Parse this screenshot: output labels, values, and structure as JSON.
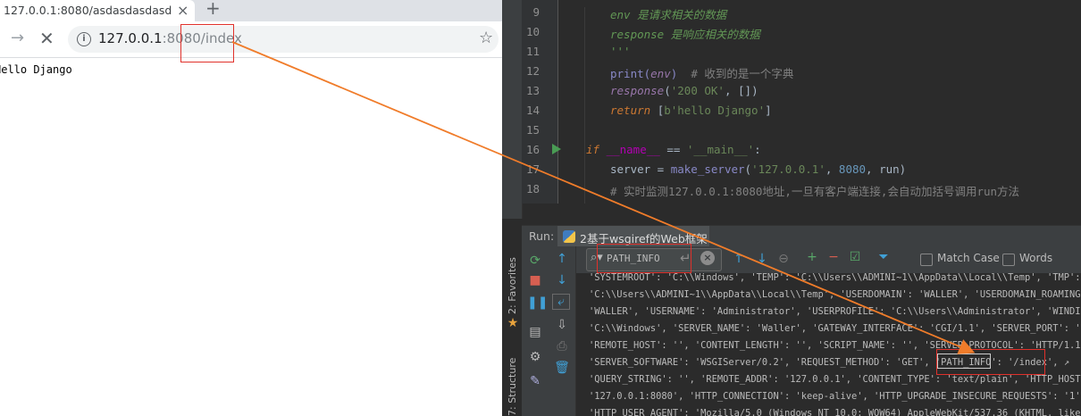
{
  "browser": {
    "tab_title": "127.0.0.1:8080/asdasdasdasd",
    "tab_close": "×",
    "new_tab": "+",
    "forward": "→",
    "stop": "✕",
    "info_icon": "i",
    "url_host": "127.0.0.1",
    "url_rest": ":8080/index",
    "star": "☆",
    "page_text": "Hello Django"
  },
  "editor": {
    "lines": [
      {
        "n": "9"
      },
      {
        "n": "10"
      },
      {
        "n": "11"
      },
      {
        "n": "12"
      },
      {
        "n": "13"
      },
      {
        "n": "14"
      },
      {
        "n": "15"
      },
      {
        "n": "16"
      },
      {
        "n": "17"
      },
      {
        "n": "18"
      }
    ],
    "code": {
      "l9": "env 是请求相关的数据",
      "l10": "response 是响应相关的数据",
      "l11": "'''",
      "l12_a": "print(",
      "l12_b": "env",
      "l12_c": ")  ",
      "l12_d": "# 收到的是一个字典",
      "l13_a": "response",
      "l13_b": "(",
      "l13_c": "'200 OK'",
      "l13_d": ", [])",
      "l14_a": "return ",
      "l14_b": "[",
      "l14_c": "b'hello Django'",
      "l14_d": "]",
      "l16_a": "if ",
      "l16_b": "__name__",
      "l16_c": " == ",
      "l16_d": "'__main__'",
      "l16_e": ":",
      "l17_a": "server = ",
      "l17_b": "make_server",
      "l17_c": "(",
      "l17_d": "'127.0.0.1'",
      "l17_e": ", ",
      "l17_f": "8080",
      "l17_g": ", run)",
      "l18": "# 实时监测127.0.0.1:8080地址,一旦有客户端连接,会自动加括号调用run方法"
    }
  },
  "run_panel": {
    "label": "Run:",
    "config_name": "2基于wsgiref的Web框架",
    "search_query": "PATH_INFO",
    "match_case": "Match Case",
    "words": "Words",
    "favorites": "2: Favorites",
    "structure": "7: Structure",
    "console_lines": [
      "'SYSTEMROOT': 'C:\\\\Windows', 'TEMP': 'C:\\\\Users\\\\ADMINI~1\\\\AppData\\\\Local\\\\Temp', 'TMP': 'C",
      "'C:\\\\Users\\\\ADMINI~1\\\\AppData\\\\Local\\\\Temp', 'USERDOMAIN': 'WALLER', 'USERDOMAIN_ROAMINGPRO",
      "'WALLER', 'USERNAME': 'Administrator', 'USERPROFILE': 'C:\\\\Users\\\\Administrator', 'WINDIR':",
      "'C:\\\\Windows', 'SERVER_NAME': 'Waller', 'GATEWAY_INTERFACE': 'CGI/1.1', 'SERVER_PORT': '80",
      "'REMOTE_HOST': '', 'CONTENT_LENGTH': '', 'SCRIPT_NAME': '', 'SERVER_PROTOCOL': 'HTTP/1.1',",
      "'SERVER_SOFTWARE': 'WSGIServer/0.2', 'REQUEST_METHOD': 'GET', 'PATH_INFO': '/index', ↗",
      "'QUERY_STRING': '', 'REMOTE_ADDR': '127.0.0.1', 'CONTENT_TYPE': 'text/plain', 'HTTP_HOST':",
      "'127.0.0.1:8080', 'HTTP_CONNECTION': 'keep-alive', 'HTTP_UPGRADE_INSECURE_REQUESTS': '1',",
      "'HTTP_USER_AGENT': 'Mozilla/5.0 (Windows NT 10.0; WOW64) AppleWebKit/537.36 (KHTML, like G"
    ]
  },
  "colors": {
    "annotation_red": "#e0312b",
    "arrow_orange": "#f07c2a"
  }
}
